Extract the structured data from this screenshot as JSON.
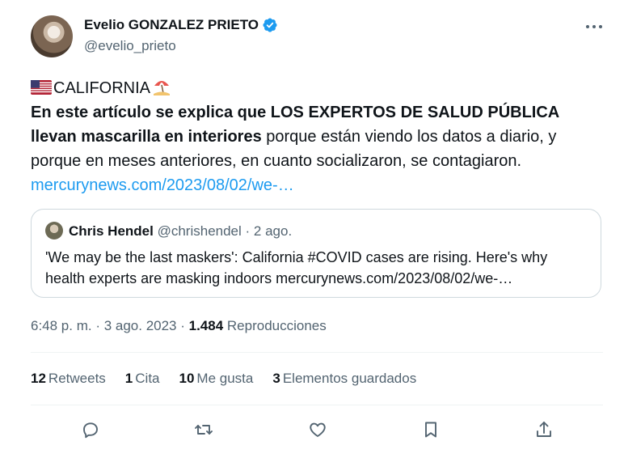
{
  "author": {
    "name": "Evelio GONZALEZ PRIETO",
    "handle": "@evelio_prieto",
    "verified_icon": "verified-badge-icon"
  },
  "tweet": {
    "headline": "CALIFORNIA",
    "line2_bold": "En este artículo se explica que LOS EXPERTOS DE SALUD PÚBLICA",
    "line3_bold": "llevan mascarilla en interiores",
    "line3_rest": " porque están viendo los datos a diario, y",
    "line4": "porque en meses anteriores, en cuanto socializaron, se contagiaron.",
    "link": "mercurynews.com/2023/08/02/we-…"
  },
  "quote": {
    "name": "Chris Hendel",
    "handle": "@chrishendel",
    "date": "· 2 ago.",
    "text_line1": "'We may be the last maskers': California #COVID cases are rising. Here's why",
    "text_line2": "health experts are masking indoors mercurynews.com/2023/08/02/we-…"
  },
  "meta": {
    "time_date": "6:48 p. m. · 3 ago. 2023 · ",
    "views_count": "1.484",
    "views_label": " Reproducciones"
  },
  "stats": [
    {
      "count": "12",
      "label": "Retweets"
    },
    {
      "count": "1",
      "label": "Cita"
    },
    {
      "count": "10",
      "label": "Me gusta"
    },
    {
      "count": "3",
      "label": "Elementos guardados"
    }
  ],
  "colors": {
    "link": "#1d9bf0",
    "verified": "#1d9bf0",
    "secondary_text": "#536471"
  }
}
